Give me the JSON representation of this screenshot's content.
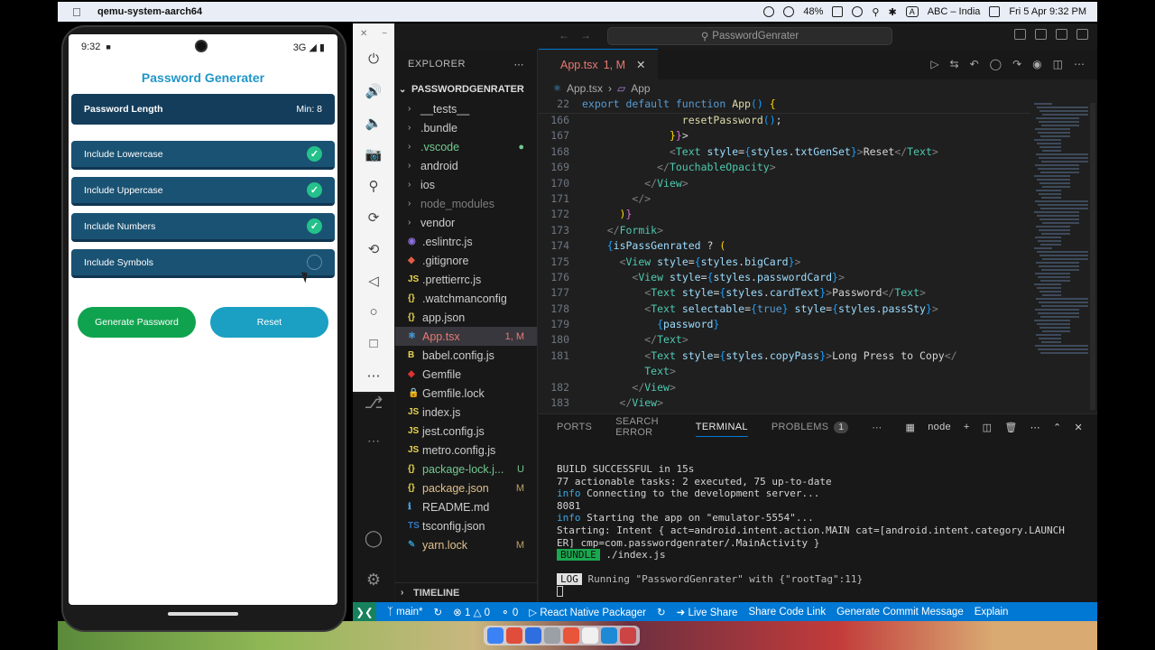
{
  "menubar": {
    "app_name": "qemu-system-aarch64",
    "battery": "48%",
    "input_source": "ABC – India",
    "clock": "Fri 5 Apr  9:32 PM",
    "input_badge": "A"
  },
  "phone": {
    "time": "9:32",
    "signal": "3G ◢ ▮",
    "title": "Password Generater",
    "length_label": "Password Length",
    "length_value": "Min: 8",
    "options": [
      {
        "label": "Include Lowercase",
        "checked": true
      },
      {
        "label": "Include Uppercase",
        "checked": true
      },
      {
        "label": "Include Numbers",
        "checked": true
      },
      {
        "label": "Include Symbols",
        "checked": false
      }
    ],
    "generate_label": "Generate Password",
    "reset_label": "Reset"
  },
  "vscode": {
    "search_text": "PasswordGenrater",
    "explorer_label": "EXPLORER",
    "project_label": "PASSWORDGENRATER",
    "files": [
      {
        "name": "__tests__",
        "kind": "folder",
        "style": "",
        "badge": ""
      },
      {
        "name": ".bundle",
        "kind": "folder",
        "style": "",
        "badge": ""
      },
      {
        "name": ".vscode",
        "kind": "folder",
        "style": "green",
        "badge": "●"
      },
      {
        "name": "android",
        "kind": "folder",
        "style": "",
        "badge": ""
      },
      {
        "name": "ios",
        "kind": "folder",
        "style": "",
        "badge": ""
      },
      {
        "name": "node_modules",
        "kind": "folder",
        "style": "dim",
        "badge": ""
      },
      {
        "name": "vendor",
        "kind": "folder",
        "style": "",
        "badge": ""
      },
      {
        "name": ".eslintrc.js",
        "kind": "eslint",
        "style": "",
        "badge": ""
      },
      {
        "name": ".gitignore",
        "kind": "git",
        "style": "",
        "badge": ""
      },
      {
        "name": ".prettierrc.js",
        "kind": "js",
        "style": "",
        "badge": ""
      },
      {
        "name": ".watchmanconfig",
        "kind": "json",
        "style": "",
        "badge": ""
      },
      {
        "name": "app.json",
        "kind": "json",
        "style": "",
        "badge": ""
      },
      {
        "name": "App.tsx",
        "kind": "tsx",
        "style": "active",
        "badge": "1, M"
      },
      {
        "name": "babel.config.js",
        "kind": "babel",
        "style": "",
        "badge": ""
      },
      {
        "name": "Gemfile",
        "kind": "ruby",
        "style": "",
        "badge": ""
      },
      {
        "name": "Gemfile.lock",
        "kind": "lock",
        "style": "",
        "badge": ""
      },
      {
        "name": "index.js",
        "kind": "js",
        "style": "",
        "badge": ""
      },
      {
        "name": "jest.config.js",
        "kind": "js",
        "style": "",
        "badge": ""
      },
      {
        "name": "metro.config.js",
        "kind": "js",
        "style": "",
        "badge": ""
      },
      {
        "name": "package-lock.j...",
        "kind": "json",
        "style": "green",
        "badge": "U"
      },
      {
        "name": "package.json",
        "kind": "json",
        "style": "orange",
        "badge": "M"
      },
      {
        "name": "README.md",
        "kind": "md",
        "style": "",
        "badge": ""
      },
      {
        "name": "tsconfig.json",
        "kind": "ts",
        "style": "",
        "badge": ""
      },
      {
        "name": "yarn.lock",
        "kind": "yarn",
        "style": "orange",
        "badge": "M"
      }
    ],
    "timeline_label": "TIMELINE",
    "tab_name": "App.tsx",
    "tab_status": "1, M",
    "breadcrumb_file": "App.tsx",
    "breadcrumb_symbol": "App",
    "sticky_line": {
      "num": "22",
      "text": "export default function App() {"
    },
    "code_lines": [
      {
        "num": "166",
        "html": "                <span class=\"fn\">resetPassword</span><span class=\"br3\">()</span>;"
      },
      {
        "num": "167",
        "html": "              <span class=\"br2\">}</span><span class=\"br\">}</span>>"
      },
      {
        "num": "168",
        "html": "              <span class=\"pun\">&lt;</span><span class=\"tag\">Text</span> <span class=\"at\">style</span>=<span class=\"br3\">{</span><span class=\"at\">styles</span>.<span class=\"at\">txtGenSet</span><span class=\"br3\">}</span><span class=\"pun\">&gt;</span>Reset<span class=\"pun\">&lt;/</span><span class=\"tag\">Text</span><span class=\"pun\">&gt;</span>"
      },
      {
        "num": "169",
        "html": "            <span class=\"pun\">&lt;/</span><span class=\"tag\">TouchableOpacity</span><span class=\"pun\">&gt;</span>"
      },
      {
        "num": "170",
        "html": "          <span class=\"pun\">&lt;/</span><span class=\"tag\">View</span><span class=\"pun\">&gt;</span>"
      },
      {
        "num": "171",
        "html": "        <span class=\"pun\">&lt;/&gt;</span>"
      },
      {
        "num": "172",
        "html": "      <span class=\"br2\">)</span><span class=\"br\">}</span>"
      },
      {
        "num": "173",
        "html": "    <span class=\"pun\">&lt;/</span><span class=\"tag\">Formik</span><span class=\"pun\">&gt;</span>"
      },
      {
        "num": "174",
        "html": "    <span class=\"br3\">{</span><span class=\"at\">isPassGenrated</span> ? <span class=\"br2\">(</span>"
      },
      {
        "num": "175",
        "html": "      <span class=\"pun\">&lt;</span><span class=\"tag\">View</span> <span class=\"at\">style</span>=<span class=\"br3\">{</span><span class=\"at\">styles</span>.<span class=\"at\">bigCard</span><span class=\"br3\">}</span><span class=\"pun\">&gt;</span>"
      },
      {
        "num": "176",
        "html": "        <span class=\"pun\">&lt;</span><span class=\"tag\">View</span> <span class=\"at\">style</span>=<span class=\"br3\">{</span><span class=\"at\">styles</span>.<span class=\"at\">passwordCard</span><span class=\"br3\">}</span><span class=\"pun\">&gt;</span>"
      },
      {
        "num": "177",
        "html": "          <span class=\"pun\">&lt;</span><span class=\"tag\">Text</span> <span class=\"at\">style</span>=<span class=\"br3\">{</span><span class=\"at\">styles</span>.<span class=\"at\">cardText</span><span class=\"br3\">}</span><span class=\"pun\">&gt;</span>Password<span class=\"pun\">&lt;/</span><span class=\"tag\">Text</span><span class=\"pun\">&gt;</span>"
      },
      {
        "num": "178",
        "html": "          <span class=\"pun\">&lt;</span><span class=\"tag\">Text</span> <span class=\"at\">selectable</span>=<span class=\"br3\">{</span><span class=\"kw\">true</span><span class=\"br3\">}</span> <span class=\"at\">style</span>=<span class=\"br3\">{</span><span class=\"at\">styles</span>.<span class=\"at\">passSty</span><span class=\"br3\">}</span><span class=\"pun\">&gt;</span>"
      },
      {
        "num": "179",
        "html": "            <span class=\"br3\">{</span><span class=\"at\">password</span><span class=\"br3\">}</span>"
      },
      {
        "num": "180",
        "html": "          <span class=\"pun\">&lt;/</span><span class=\"tag\">Text</span><span class=\"pun\">&gt;</span>"
      },
      {
        "num": "181",
        "html": "          <span class=\"pun\">&lt;</span><span class=\"tag\">Text</span> <span class=\"at\">style</span>=<span class=\"br3\">{</span><span class=\"at\">styles</span>.<span class=\"at\">copyPass</span><span class=\"br3\">}</span><span class=\"pun\">&gt;</span>Long Press to Copy<span class=\"pun\">&lt;/</span>"
      },
      {
        "num": "",
        "html": "          <span class=\"tag\">Text</span><span class=\"pun\">&gt;</span>"
      },
      {
        "num": "182",
        "html": "        <span class=\"pun\">&lt;/</span><span class=\"tag\">View</span><span class=\"pun\">&gt;</span>"
      },
      {
        "num": "183",
        "html": "      <span class=\"pun\">&lt;/</span><span class=\"tag\">View</span><span class=\"pun\">&gt;</span>"
      }
    ],
    "panel_tabs": [
      "PORTS",
      "SEARCH ERROR",
      "TERMINAL",
      "PROBLEMS"
    ],
    "problems_count": "1",
    "terminal_shell": "node",
    "terminal_lines": [
      "BUILD SUCCESSFUL in 15s",
      "77 actionable tasks: 2 executed, 75 up-to-date",
      "Connecting to the development server...",
      "8081",
      "Starting the app on \"emulator-5554\"...",
      "Starting: Intent { act=android.intent.action.MAIN cat=[android.intent.category.LAUNCH",
      "ER] cmp=com.passwordgenrater/.MainActivity }",
      "./index.js",
      "Running \"PasswordGenrater\" with {\"rootTag\":11}"
    ],
    "info_tag": "info",
    "bundle_tag": "BUNDLE",
    "log_tag": "LOG",
    "status": {
      "branch": "main*",
      "errors": "1",
      "warnings": "0",
      "ports": "0",
      "packager": "React Native Packager",
      "live_share": "Live Share",
      "share_code": "Share Code Link",
      "commit": "Generate Commit Message",
      "explain": "Explain"
    }
  }
}
